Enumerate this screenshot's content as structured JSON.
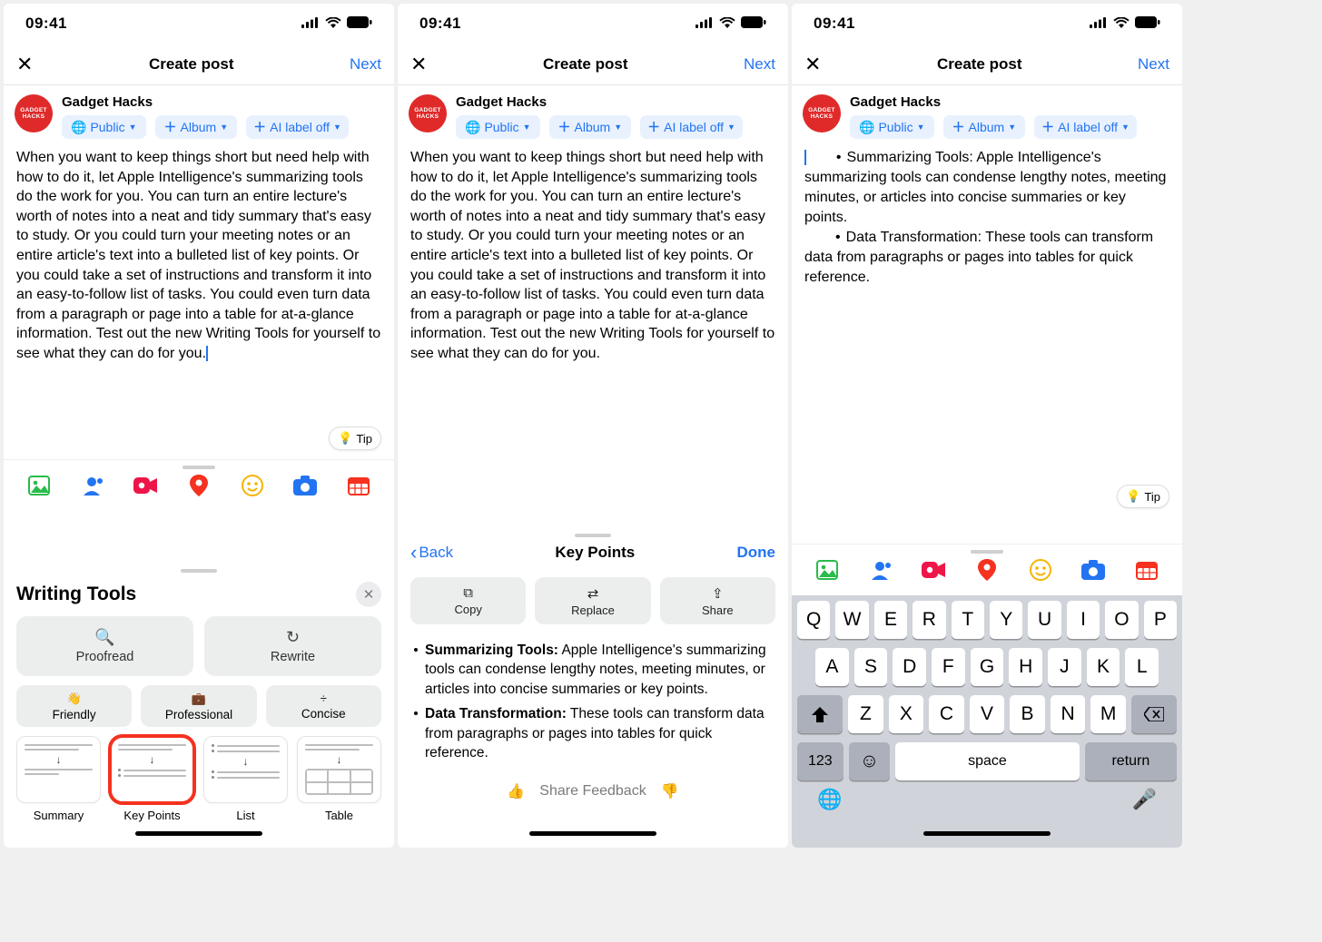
{
  "status": {
    "time": "09:41"
  },
  "header": {
    "title": "Create post",
    "next": "Next"
  },
  "composer": {
    "user": "Gadget Hacks",
    "avatar_text": "GADGET HACKS",
    "chips": {
      "audience": "Public",
      "album": "Album",
      "ai": "AI label off"
    }
  },
  "post_text": "When you want to keep things short but need help with how to do it, let Apple Intelligence's summarizing tools do the work for you. You can turn an entire lecture's worth of notes into a neat and tidy summary that's easy to study. Or you could turn your meeting notes or an entire article's text into a bulleted list of key points. Or you could take a set of instructions and transform it into an easy-to-follow list of tasks. You could even turn data from a paragraph or page into a table for at-a-glance information. Test out the new Writing Tools for yourself to see what they can do for you.",
  "tip_label": "Tip",
  "writing_tools": {
    "title": "Writing Tools",
    "proofread": "Proofread",
    "rewrite": "Rewrite",
    "friendly": "Friendly",
    "professional": "Professional",
    "concise": "Concise",
    "summary": "Summary",
    "key_points": "Key Points",
    "list": "List",
    "table": "Table"
  },
  "key_points": {
    "back": "Back",
    "title": "Key Points",
    "done": "Done",
    "actions": {
      "copy": "Copy",
      "replace": "Replace",
      "share": "Share"
    },
    "bullets": [
      {
        "label": "Summarizing Tools:",
        "text": "Apple Intelligence's summarizing tools can condense lengthy notes, meeting minutes, or articles into concise summaries or key points."
      },
      {
        "label": "Data Transformation:",
        "text": "These tools can transform data from paragraphs or pages into tables for quick reference."
      }
    ],
    "feedback": "Share Feedback"
  },
  "phone3_body": [
    "Summarizing Tools: Apple Intelligence's summarizing tools can condense lengthy notes, meeting minutes, or articles into concise summaries or key points.",
    "Data Transformation: These tools can transform data from paragraphs or pages into tables for quick reference."
  ],
  "keyboard": {
    "r1": [
      "Q",
      "W",
      "E",
      "R",
      "T",
      "Y",
      "U",
      "I",
      "O",
      "P"
    ],
    "r2": [
      "A",
      "S",
      "D",
      "F",
      "G",
      "H",
      "J",
      "K",
      "L"
    ],
    "r3": [
      "Z",
      "X",
      "C",
      "V",
      "B",
      "N",
      "M"
    ],
    "num": "123",
    "space": "space",
    "ret": "return"
  }
}
